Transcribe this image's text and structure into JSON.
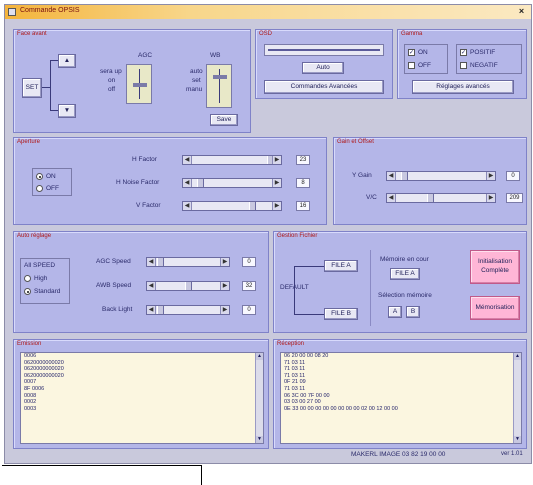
{
  "window": {
    "title": "Commande OPSIS",
    "close": "×"
  },
  "face_avant": {
    "title": "Face avant",
    "set_label": "SET",
    "up_arrow": "▲",
    "down_arrow": "▼",
    "agc_title": "AGC",
    "agc_opts": [
      "sera up",
      "on",
      "off"
    ],
    "wb_title": "WB",
    "wb_opts": [
      "auto",
      "set",
      "manu"
    ],
    "save_label": "Save"
  },
  "osd": {
    "title": "OSD",
    "auto_label": "Auto",
    "adv_label": "Commandes Avancées"
  },
  "gamma": {
    "title": "Gamma",
    "on": "ON",
    "off": "OFF",
    "positif": "POSITIF",
    "negatif": "NEGATIF",
    "adv_label": "Réglages avancés"
  },
  "aperture": {
    "title": "Aperture",
    "on": "ON",
    "off": "OFF",
    "rows": [
      {
        "label": "H Factor",
        "value": "23"
      },
      {
        "label": "H Noise Factor",
        "value": "8"
      },
      {
        "label": "V Factor",
        "value": "16"
      }
    ]
  },
  "gain": {
    "title": "Gain et Offset",
    "rows": [
      {
        "label": "Y Gain",
        "value": "0"
      },
      {
        "label": "V/C",
        "value": "209"
      }
    ]
  },
  "auto": {
    "title": "Auto réglage",
    "speed_label": "All SPEED",
    "high": "High",
    "standard": "Standard",
    "rows": [
      {
        "label": "AGC Speed",
        "value": "0"
      },
      {
        "label": "AWB Speed",
        "value": "32"
      },
      {
        "label": "Back Light",
        "value": "0"
      }
    ]
  },
  "fichier": {
    "title": "Gestion Fichier",
    "default_label": "DEFAULT",
    "file_a": "FILE A",
    "file_b": "FILE B",
    "memoire_label": "Mémoire en cour",
    "memoire_value": "FILE A",
    "selection_label": "Sélection mémoire",
    "sel_a": "A",
    "sel_b": "B",
    "init_label": "Initialisation Complète",
    "mem_label": "Mémorisation"
  },
  "emission": {
    "title": "Emission",
    "lines": [
      "0006",
      "0620000000020",
      "0620000000020",
      "0620000000020",
      "0007",
      "8F 0006",
      "0008",
      "0002",
      "0003"
    ]
  },
  "reception": {
    "title": "Réception",
    "lines": [
      "06 20 00 00 08 20",
      "71 03 11",
      "71 03 11",
      "71 03 11",
      "0F 21 09",
      "71 03 11",
      "06 3C 00 7F 00 00",
      "03 03 00 27 00",
      "0E 33 00 00 00 00 00 00 00 00 02 00 12 00 00"
    ]
  },
  "status": {
    "text": "MAKERL IMAGE 03 82 19 00 00",
    "version": "ver 1.01"
  }
}
